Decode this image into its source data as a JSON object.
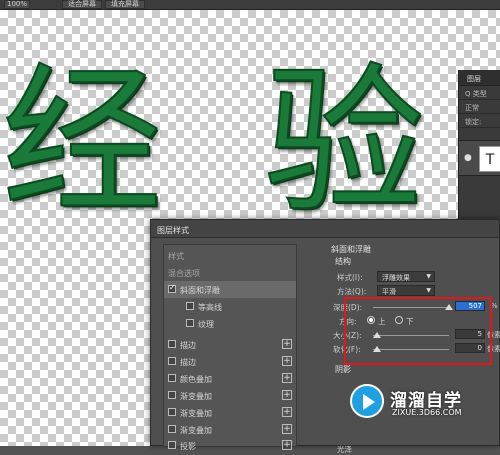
{
  "toolbar": {
    "zoom": "100%",
    "btn1": "适合屏幕",
    "btn2": "填充屏幕"
  },
  "canvas": {
    "char1": "经",
    "char2": "验",
    "text_color": "#1a7a3a"
  },
  "layers_panel": {
    "title": "图层",
    "kind": "Q 类型",
    "blend": "正常",
    "lock": "锁定:",
    "thumb_letter": "T"
  },
  "dialog": {
    "title": "图层样式",
    "left_items": [
      {
        "label": "样式",
        "type": "header"
      },
      {
        "label": "混合选项",
        "type": "header"
      },
      {
        "label": "斜面和浮雕",
        "checked": true,
        "selected": true
      },
      {
        "label": "等高线",
        "sub": true
      },
      {
        "label": "纹理",
        "sub": true
      },
      {
        "label": "描边",
        "plus": true
      },
      {
        "label": "描边",
        "plus": true
      },
      {
        "label": "颜色叠加",
        "plus": true
      },
      {
        "label": "渐变叠加",
        "plus": true
      },
      {
        "label": "渐变叠加",
        "plus": true
      },
      {
        "label": "渐变叠加",
        "plus": true
      },
      {
        "label": "投影",
        "plus": true
      }
    ],
    "section_title": "斜面和浮雕",
    "structure_title": "结构",
    "style_label": "样式(I):",
    "style_value": "浮雕效果",
    "method_label": "方法(Q):",
    "method_value": "平滑",
    "depth_label": "深度(D):",
    "depth_value": "507",
    "depth_unit": "%",
    "direction_label": "方向:",
    "dir_up": "上",
    "dir_down": "下",
    "size_label": "大小(Z):",
    "size_value": "5",
    "size_unit": "像素",
    "soften_label": "软化(F):",
    "soften_value": "0",
    "soften_unit": "像素",
    "shading_title": "阴影",
    "light_label": "光泽"
  },
  "watermark": {
    "title": "溜溜自学",
    "url": "ZIXUE.3D66.COM"
  }
}
